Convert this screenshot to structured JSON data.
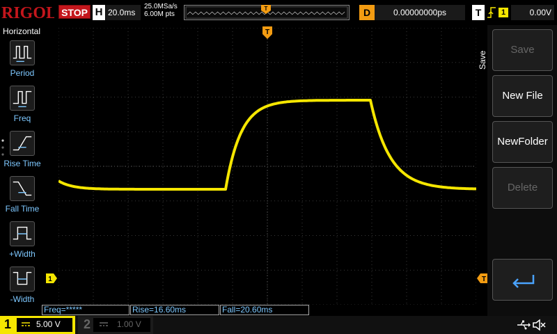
{
  "brand": {
    "name": "RIGOL"
  },
  "run_state": {
    "label": "STOP"
  },
  "horizontal": {
    "badge": "H",
    "timebase": "20.0ms",
    "sample_rate": "25.0MSa/s",
    "memory_depth": "6.00M pts"
  },
  "delay": {
    "badge": "D",
    "value": "0.00000000ps"
  },
  "trigger": {
    "badge": "T",
    "source": "1",
    "level": "0.00V",
    "edge_icon": "rising-edge-icon"
  },
  "left_menu": {
    "title": "Horizontal",
    "items": [
      {
        "label": "Period",
        "icon": "period-icon"
      },
      {
        "label": "Freq",
        "icon": "freq-icon"
      },
      {
        "label": "Rise Time",
        "icon": "rise-time-icon"
      },
      {
        "label": "Fall Time",
        "icon": "fall-time-icon"
      },
      {
        "label": "+Width",
        "icon": "positive-width-icon"
      },
      {
        "label": "-Width",
        "icon": "negative-width-icon"
      }
    ]
  },
  "right_menu": {
    "title": "Save",
    "keys": [
      {
        "label": "Save",
        "disabled": true
      },
      {
        "label": "New File",
        "disabled": false
      },
      {
        "label": "NewFolder",
        "disabled": false
      },
      {
        "label": "Delete",
        "disabled": true
      },
      {
        "label": "",
        "icon": "enter-arrow-icon"
      }
    ]
  },
  "measurements": {
    "freq": "Freq=*****",
    "rise": "Rise=16.60ms",
    "fall": "Fall=20.60ms"
  },
  "channels": {
    "ch1": {
      "number": "1",
      "scale": "5.00 V",
      "color": "#f5e600",
      "active": true
    },
    "ch2": {
      "number": "2",
      "scale": "1.00 V",
      "color": "#666666",
      "active": false
    }
  },
  "markers": {
    "ch1_ground": "1",
    "trigger_pos": "T",
    "trigger_level": "T"
  },
  "colors": {
    "trace": "#f5e600",
    "trigger": "#f39c12",
    "accent": "#7ec8ff",
    "stop": "#c4161c"
  }
}
